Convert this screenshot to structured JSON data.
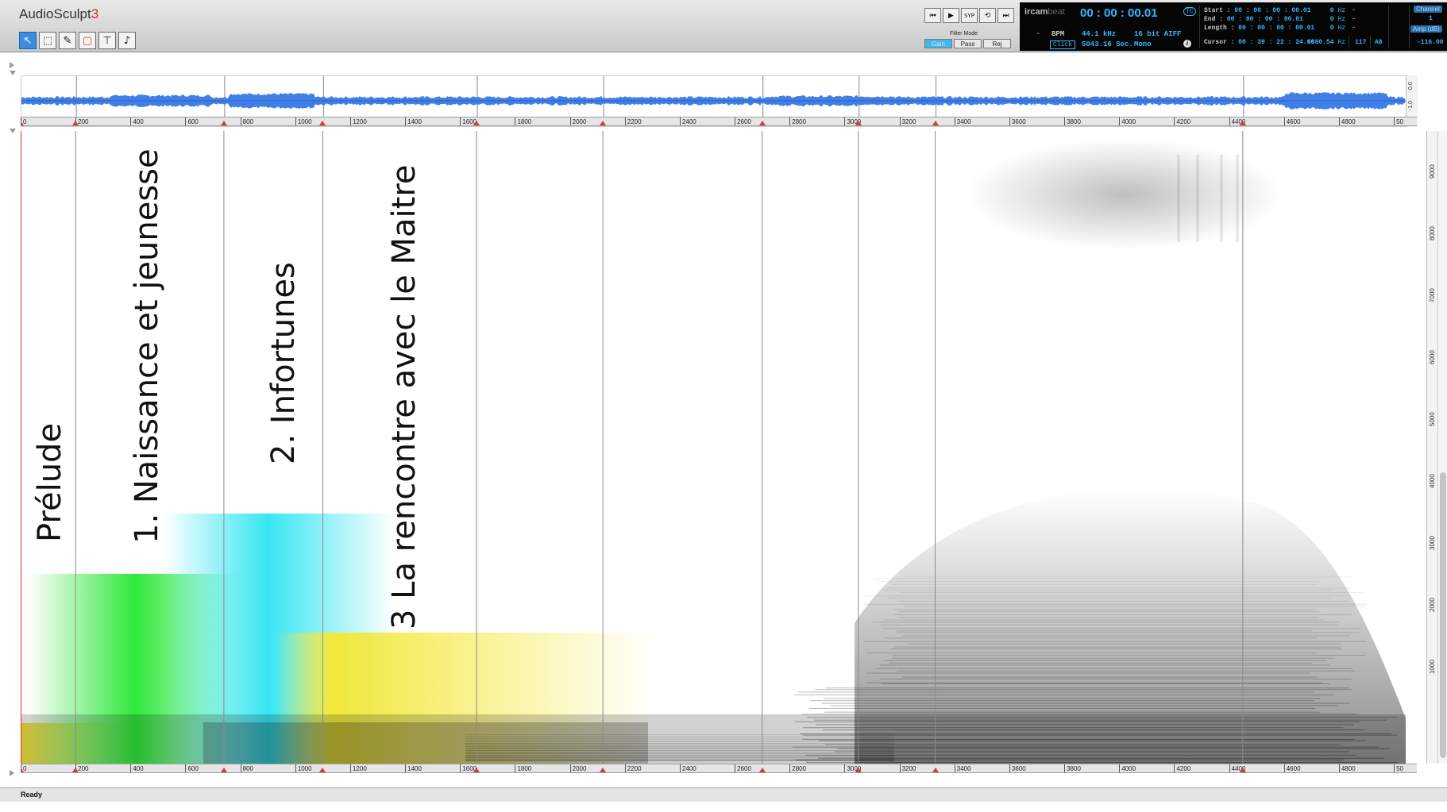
{
  "app": {
    "title": "AudioSculpt",
    "version": "3"
  },
  "tools": [
    {
      "name": "pointer-tool",
      "glyph": "↖",
      "active": true
    },
    {
      "name": "selection-tool",
      "glyph": "⬚",
      "active": false
    },
    {
      "name": "pencil-tool",
      "glyph": "✎",
      "active": false
    },
    {
      "name": "surface-tool",
      "glyph": "▢",
      "active": false
    },
    {
      "name": "filter-tool",
      "glyph": "⊤",
      "active": false
    },
    {
      "name": "note-tool",
      "glyph": "♪",
      "active": false
    }
  ],
  "transport": {
    "syp_label": "SYP"
  },
  "filter_mode": {
    "label": "Filter Mode",
    "modes": [
      "Gain",
      "Pass",
      "Rej"
    ],
    "active": "Gain"
  },
  "status_panel": {
    "brand": "ircam",
    "brand_suffix": "beat",
    "main_time": "00 : 00 : 00.01",
    "tc_label": "TC",
    "bpm_label": "BPM",
    "click_label": "Click",
    "sample_rate": "44.1 kHz",
    "bit_format": "16 bit AIFF",
    "duration": "5043.16 Sec.",
    "channels_mode": "Mono",
    "start": {
      "label": "Start :",
      "value": "00 : 00 : 00 : 00.01",
      "hz": "0",
      "unit": "Hz"
    },
    "end": {
      "label": "End :",
      "value": "00 : 00 : 00 : 00.01",
      "hz": "0",
      "unit": "Hz"
    },
    "length": {
      "label": "Length :",
      "value": "00 : 00 : 00 : 00.01",
      "hz": "0",
      "unit": "Hz"
    },
    "cursor": {
      "label": "Cursor :",
      "value": "00 : 39 : 22 : 24.06",
      "hz": "6880.54",
      "unit": "Hz"
    },
    "note_num": "117",
    "note_name": "A8",
    "channel_label": "Channel",
    "channel_value": "1",
    "amp_label": "Amp (dB)",
    "amp_value": "-116.00",
    "dash": "-"
  },
  "wave_scale": [
    "0.0",
    "-1.0"
  ],
  "ruler": {
    "ticks": [
      "0",
      "200",
      "400",
      "600",
      "800",
      "1000",
      "1200",
      "1400",
      "1600",
      "1800",
      "2000",
      "2200",
      "2400",
      "2600",
      "2800",
      "3000",
      "3200",
      "3400",
      "3600",
      "3800",
      "4000",
      "4200",
      "4400",
      "4600",
      "4800",
      "50"
    ],
    "markers_seconds": [
      0,
      200,
      740,
      1100,
      1660,
      2120,
      2700,
      3050,
      3330,
      4450
    ]
  },
  "freq_scale": [
    "9000",
    "8000",
    "7000",
    "6000",
    "5000",
    "4000",
    "3000",
    "2000",
    "1000"
  ],
  "sections": [
    {
      "label": "Prélude",
      "color": "#f3e83a"
    },
    {
      "label": "1. Naissance et jeunesse",
      "color": "#2ee83a"
    },
    {
      "label": "2. Infortunes",
      "color": "#37e6f2"
    },
    {
      "label": "3 La rencontre avec le Maitre",
      "color": "#f3e83a"
    }
  ],
  "statusbar": {
    "text": "Ready"
  }
}
